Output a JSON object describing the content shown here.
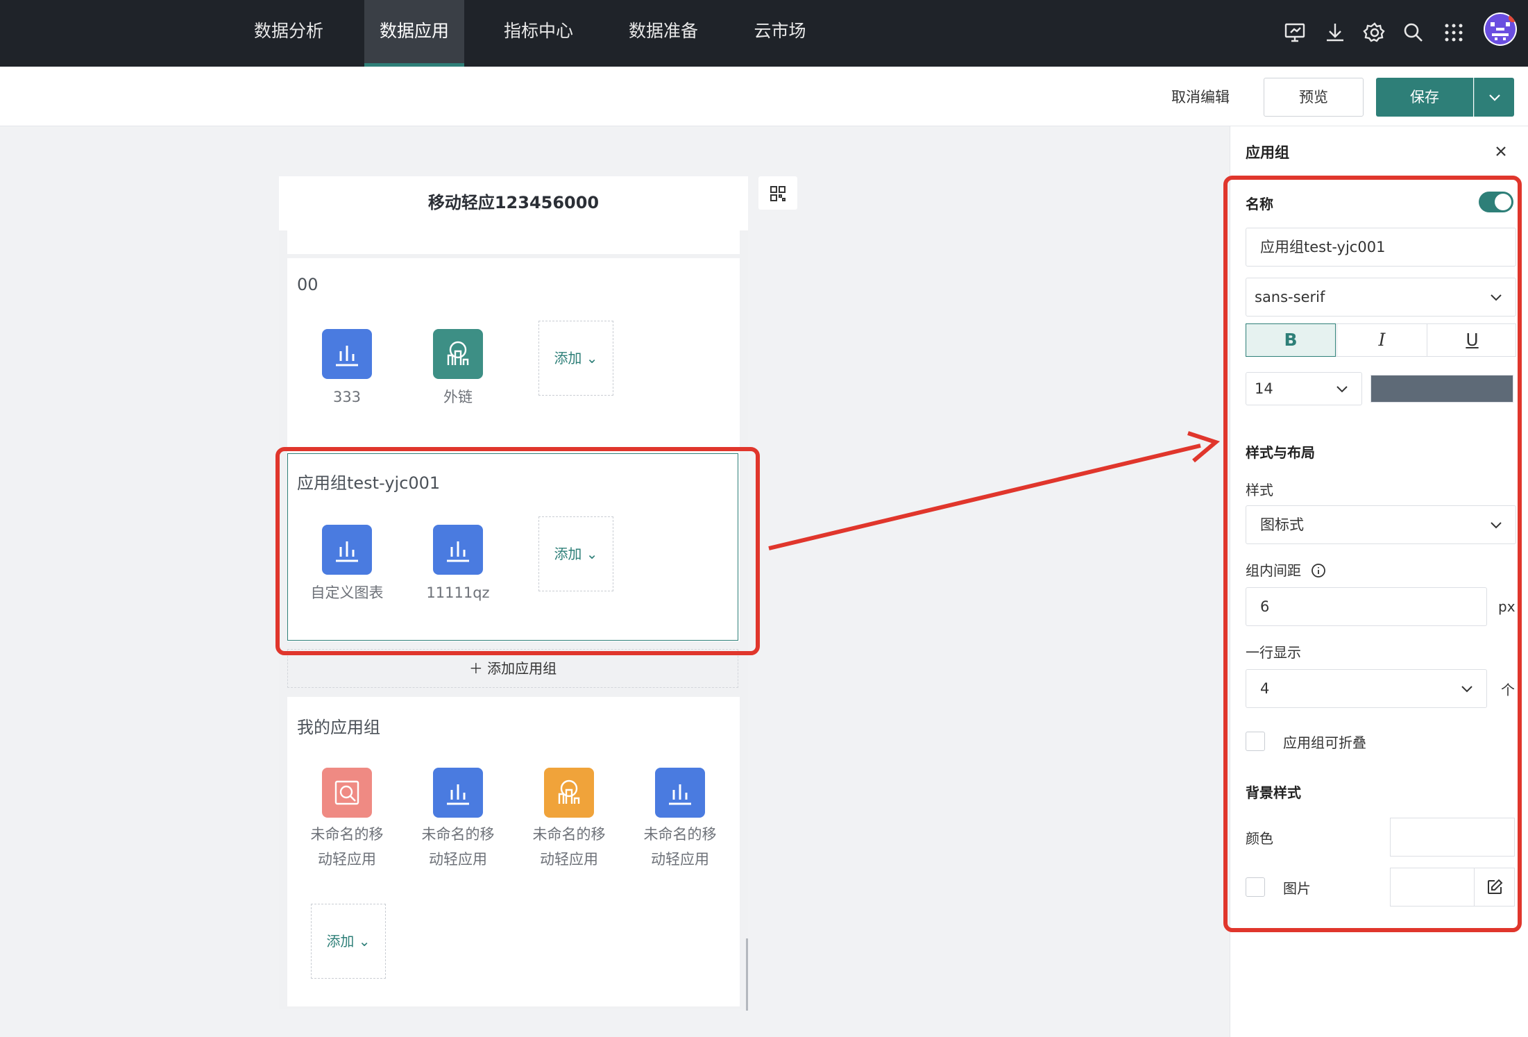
{
  "nav": {
    "tabs": [
      "数据分析",
      "数据应用",
      "指标中心",
      "数据准备",
      "云市场"
    ],
    "active_index": 1
  },
  "header_icons": [
    "monitor-icon",
    "download-icon",
    "gear-icon",
    "search-icon",
    "apps-grid-icon",
    "user-avatar"
  ],
  "toolbar": {
    "cancel_label": "取消编辑",
    "preview_label": "预览",
    "save_label": "保存"
  },
  "canvas": {
    "title": "移动轻应123456000",
    "groups": [
      {
        "title": "00",
        "apps": [
          {
            "label": "333",
            "icon": "bar-chart-icon",
            "color": "#4a7be0"
          },
          {
            "label": "外链",
            "icon": "link-app-icon",
            "color": "#3d8f85"
          }
        ],
        "add_label": "添加"
      },
      {
        "title": "应用组test-yjc001",
        "apps": [
          {
            "label": "自定义图表",
            "icon": "bar-chart-icon",
            "color": "#4a7be0"
          },
          {
            "label": "11111qz",
            "icon": "bar-chart-icon",
            "color": "#4a7be0"
          }
        ],
        "add_label": "添加"
      },
      {
        "title": "我的应用组",
        "apps": [
          {
            "label_line1": "未命名的移",
            "label_line2": "动轻应用",
            "icon": "search-report-icon",
            "color": "#ef8a83"
          },
          {
            "label_line1": "未命名的移",
            "label_line2": "动轻应用",
            "icon": "bar-chart-icon",
            "color": "#4a7be0"
          },
          {
            "label_line1": "未命名的移",
            "label_line2": "动轻应用",
            "icon": "link-app-icon",
            "color": "#f0a33a"
          },
          {
            "label_line1": "未命名的移",
            "label_line2": "动轻应用",
            "icon": "bar-chart-icon",
            "color": "#4a7be0"
          }
        ],
        "add_label": "添加"
      }
    ],
    "add_group_label": "添加应用组"
  },
  "panel": {
    "title": "应用组",
    "name_label": "名称",
    "name_toggle_on": true,
    "name_value": "应用组test-yjc001",
    "font_value": "sans-serif",
    "format": {
      "bold": "B",
      "italic": "I",
      "underline": "U",
      "bold_on": true
    },
    "font_size": "14",
    "font_color": "#5e6a77",
    "section_style": "样式与布局",
    "style_label": "样式",
    "style_value": "图标式",
    "spacing_label": "组内间距",
    "spacing_value": "6",
    "spacing_unit": "px",
    "per_row_label": "一行显示",
    "per_row_value": "4",
    "per_row_unit": "个",
    "collapsible_label": "应用组可折叠",
    "collapsible_checked": false,
    "section_bg": "背景样式",
    "color_label": "颜色",
    "image_label": "图片",
    "image_checked": false
  },
  "colors": {
    "accent": "#2e7f78",
    "topbar": "#1f2329",
    "annotation": "#e0362c"
  }
}
